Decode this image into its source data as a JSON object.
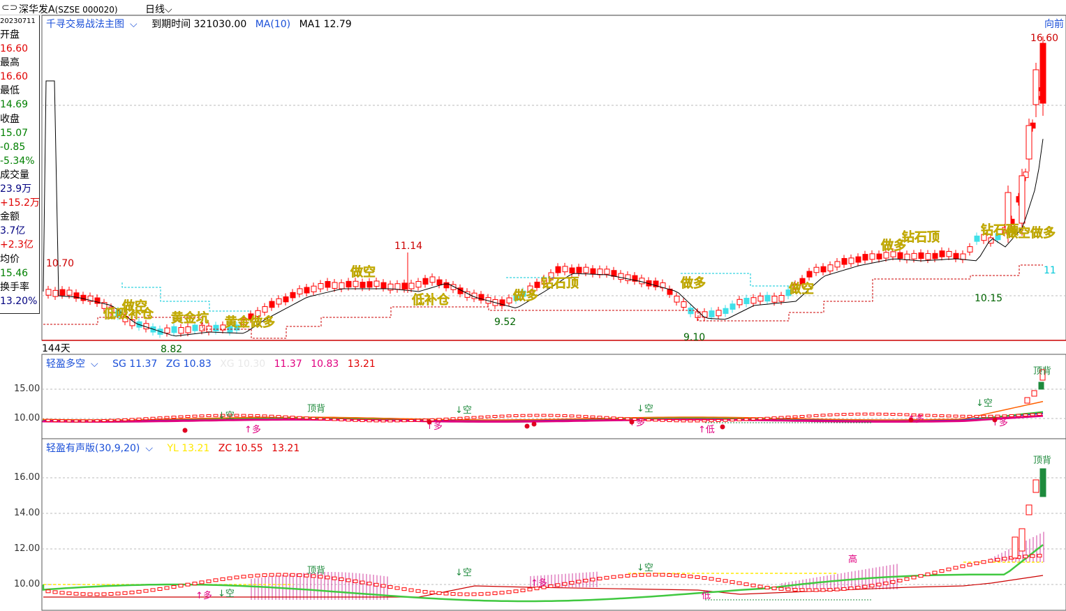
{
  "header": {
    "name": "深华发A",
    "code": "(SZSE  000020)",
    "period": "日线",
    "period_chevron": "chevron-down-icon"
  },
  "side_panel": {
    "date": "20230711",
    "open_label": "开盘",
    "open": "16.60",
    "high_label": "最高",
    "high": "16.60",
    "low_label": "最低",
    "low": "14.69",
    "close_label": "收盘",
    "close": "15.07",
    "change": "-0.85",
    "change_pct": "-5.34%",
    "volume_label": "成交量",
    "volume": "23.9万",
    "volume_change": "+15.2万",
    "amount_label": "金额",
    "amount": "3.7亿",
    "amount_change": "+2.3亿",
    "avg_label": "均价",
    "avg": "15.46",
    "turnover_label": "换手率",
    "turnover": "13.20%"
  },
  "main_panel": {
    "indicator": "千寻交易战法主图",
    "expire": "到期时间 321030.00",
    "ma_label": "MA(10)",
    "ma1": "MA1 12.79",
    "right_link": "向前",
    "price_labels": {
      "high_start": "10.70",
      "low1": "8.82",
      "peak": "11.14",
      "low2": "9.52",
      "low3": "9.10",
      "low4": "10.15",
      "top": "16.60",
      "right_num": "11"
    },
    "signals": [
      "做空",
      "低吸补仓",
      "黄金坑",
      "黄金做多",
      "低补仓",
      "做多",
      "钻石顶",
      "做空",
      "做多",
      "做空",
      "做多",
      "钻石顶",
      "钻石顶",
      "做空做多"
    ],
    "days": "144天",
    "colors": {
      "up": "#ff0000",
      "down_cyan": "#40e0e8",
      "ma": "#000000",
      "support": "#cc0000",
      "resist": "#00c8d8",
      "signal": "#ffe800"
    }
  },
  "panel2": {
    "name": "轻盈多空",
    "sg": "SG 11.37",
    "zg": "ZG 10.83",
    "xg": "XG 10.30",
    "v1": "11.37",
    "v2": "10.83",
    "v3": "13.21",
    "yticks": [
      "15.00",
      "10.00"
    ],
    "marks": [
      "顶背",
      "↓空",
      "↓空",
      "↓空",
      "↑多",
      "↑多",
      "↑多",
      "↑低",
      "↑多",
      "↑多",
      "↓空",
      "顶背"
    ]
  },
  "panel3": {
    "name": "轻盈有声版(30,9,20)",
    "yl": "YL 13.21",
    "zc": "ZC 10.55",
    "v1": "13.21",
    "yticks": [
      "16.00",
      "14.00",
      "12.00",
      "10.00"
    ],
    "marks": [
      "顶背",
      "↓空",
      "↓空",
      "↓空",
      "↑多",
      "↑多",
      "低",
      "高",
      "顶背"
    ]
  }
}
